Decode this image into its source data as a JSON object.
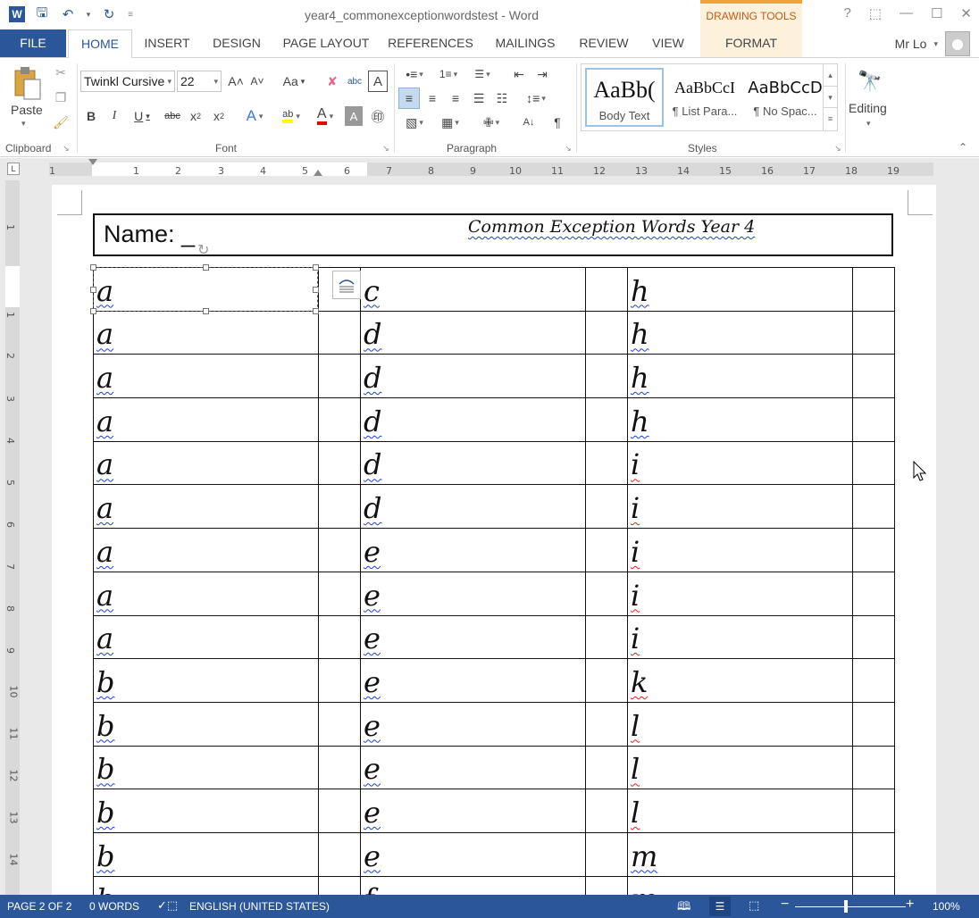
{
  "window": {
    "title": "year4_commonexceptionwordstest - Word",
    "contextual_tab_group": "DRAWING TOOLS",
    "user_name": "Mr Lo"
  },
  "tabs": [
    "FILE",
    "HOME",
    "INSERT",
    "DESIGN",
    "PAGE LAYOUT",
    "REFERENCES",
    "MAILINGS",
    "REVIEW",
    "VIEW",
    "FORMAT"
  ],
  "ribbon": {
    "clipboard": {
      "paste_label": "Paste",
      "group_label": "Clipboard"
    },
    "font": {
      "font_name": "Twinkl Cursive",
      "font_size": "22",
      "group_label": "Font",
      "change_case": "Aa"
    },
    "paragraph": {
      "group_label": "Paragraph"
    },
    "styles": {
      "group_label": "Styles",
      "items": [
        {
          "sample": "AaBb(",
          "name": "Body Text"
        },
        {
          "sample": "AaBbCcI",
          "name": "¶ List Para..."
        },
        {
          "sample": "AaBbCcD",
          "name": "¶ No Spac..."
        }
      ]
    },
    "editing": {
      "label": "Editing"
    }
  },
  "document": {
    "name_label": "Name: _",
    "header_title": "Common Exception Words  Year 4",
    "rows": [
      [
        "a",
        "c",
        "h"
      ],
      [
        "a",
        "d",
        "h"
      ],
      [
        "a",
        "d",
        "h"
      ],
      [
        "a",
        "d",
        "h"
      ],
      [
        "a",
        "d",
        "i"
      ],
      [
        "a",
        "d",
        "i"
      ],
      [
        "a",
        "e",
        "i"
      ],
      [
        "a",
        "e",
        "i"
      ],
      [
        "a",
        "e",
        "i"
      ],
      [
        "b",
        "e",
        "k"
      ],
      [
        "b",
        "e",
        "l"
      ],
      [
        "b",
        "e",
        "l"
      ],
      [
        "b",
        "e",
        "l"
      ],
      [
        "b",
        "e",
        "m"
      ],
      [
        "b",
        "f",
        "m"
      ]
    ]
  },
  "status": {
    "page": "PAGE 2 OF 2",
    "words": "0 WORDS",
    "language": "ENGLISH (UNITED STATES)",
    "zoom": "100%"
  },
  "ruler": {
    "h_ticks": [
      "1",
      "1",
      "2",
      "3",
      "4",
      "5",
      "6",
      "7",
      "8",
      "9",
      "10",
      "11",
      "12",
      "13",
      "14",
      "15",
      "16",
      "17",
      "18",
      "19"
    ],
    "v_ticks": [
      "1",
      "1",
      "2",
      "3",
      "4",
      "5",
      "6",
      "7",
      "8",
      "9",
      "10",
      "11",
      "12",
      "13",
      "14"
    ]
  }
}
